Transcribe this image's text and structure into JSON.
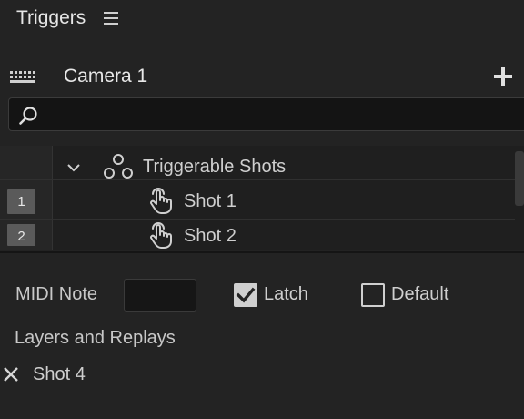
{
  "panel": {
    "title": "Triggers"
  },
  "toolbar": {
    "camera_name": "Camera 1"
  },
  "search": {
    "value": "",
    "placeholder": ""
  },
  "tree": {
    "group_label": "Triggerable Shots",
    "shots": [
      {
        "number": "1",
        "label": "Shot 1"
      },
      {
        "number": "2",
        "label": "Shot 2"
      }
    ]
  },
  "settings": {
    "midi_note_label": "MIDI Note",
    "midi_note_value": "",
    "latch_label": "Latch",
    "latch_checked": true,
    "default_label": "Default",
    "default_checked": false
  },
  "layers": {
    "section_label": "Layers and Replays",
    "items": [
      {
        "label": "Shot 4"
      }
    ]
  },
  "colors": {
    "background": "#232323",
    "field": "#141414",
    "text": "#cfcfcf",
    "row_number_bg": "#5a5a5a"
  }
}
